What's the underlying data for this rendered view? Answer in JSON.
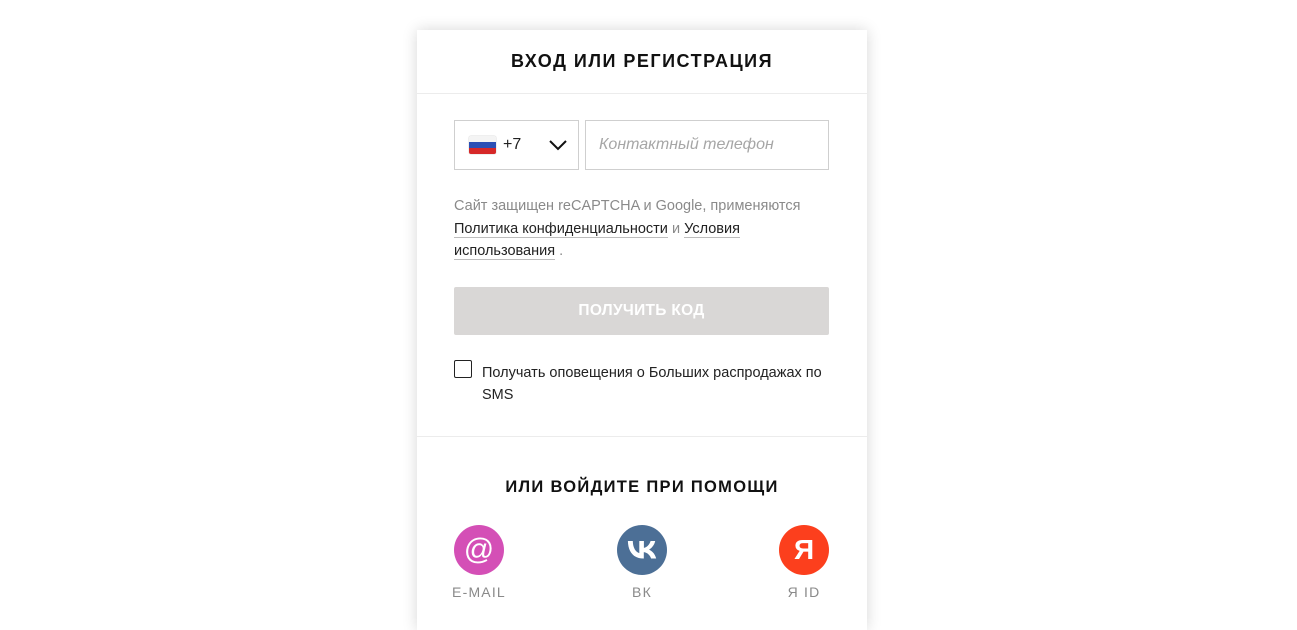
{
  "header": {
    "title": "ВХОД ИЛИ РЕГИСТРАЦИЯ"
  },
  "phone": {
    "country_flag": "russia-flag-icon",
    "country_code": "+7",
    "placeholder": "Контактный телефон",
    "value": ""
  },
  "recaptcha": {
    "text_before": "Сайт защищен reCAPTCHA и Google, применяются",
    "privacy_link": "Политика конфиденциальности",
    "conjunction": "и",
    "terms_link": "Условия использования",
    "text_after": "."
  },
  "submit": {
    "label": "ПОЛУЧИТЬ КОД",
    "bg_color": "#d9d7d6"
  },
  "sms_optin": {
    "label": "Получать оповещения о Больших распродажах по SMS",
    "checked": false
  },
  "alt_login": {
    "title": "ИЛИ ВОЙДИТЕ ПРИ ПОМОЩИ",
    "providers": [
      {
        "icon": "at-sign-icon",
        "label": "E-MAIL",
        "glyph": "@",
        "color": "#d44fb6"
      },
      {
        "icon": "vk-icon",
        "label": "ВК",
        "color": "#4c6f96"
      },
      {
        "icon": "yandex-icon",
        "label": "Я ID",
        "glyph": "Я",
        "color": "#fc3f1d"
      }
    ]
  }
}
